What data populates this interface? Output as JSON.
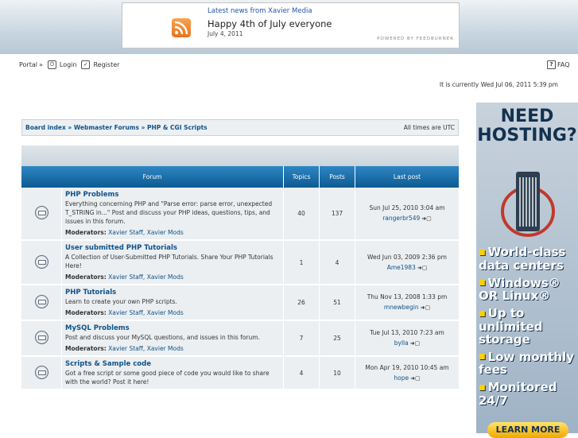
{
  "news": {
    "header": "Latest news from Xavier Media",
    "title": "Happy 4th of July everyone",
    "date": "July 4, 2011",
    "powered": "POWERED BY FEEDBURNER"
  },
  "nav": {
    "portal": "Portal",
    "sep": "»",
    "login": "Login",
    "register": "Register",
    "faq": "FAQ"
  },
  "current_time": "It is currently Wed Jul 06, 2011 5:39 pm",
  "breadcrumb": "Board index » Webmaster Forums » PHP & CGI Scripts",
  "timezone": "All times are UTC",
  "table": {
    "headers": {
      "forum": "Forum",
      "topics": "Topics",
      "posts": "Posts",
      "last": "Last post"
    },
    "mods_label": "Moderators:",
    "rows": [
      {
        "name": "PHP Problems",
        "desc": "Everything concerning PHP and \"Parse error: parse error, unexpected T_STRING in...\" Post and discuss your PHP ideas, questions, tips, and issues in this forum.",
        "mods": "Xavier Staff, Xavier Mods",
        "topics": "40",
        "posts": "137",
        "last_date": "Sun Jul 25, 2010 3:04 am",
        "last_user": "rangerbr549"
      },
      {
        "name": "User submitted PHP Tutorials",
        "desc": "A Collection of User-Submitted PHP Tutorials. Share Your PHP Tutorials Here!",
        "mods": "Xavier Staff, Xavier Mods",
        "topics": "1",
        "posts": "4",
        "last_date": "Wed Jun 03, 2009 2:36 pm",
        "last_user": "Ame1983"
      },
      {
        "name": "PHP Tutorials",
        "desc": "Learn to create your own PHP scripts.",
        "mods": "Xavier Staff, Xavier Mods",
        "topics": "26",
        "posts": "51",
        "last_date": "Thu Nov 13, 2008 1:33 pm",
        "last_user": "mnewbegin"
      },
      {
        "name": "MySQL Problems",
        "desc": "Post and discuss your MySQL questions, and issues in this forum.",
        "mods": "Xavier Staff, Xavier Mods",
        "topics": "7",
        "posts": "25",
        "last_date": "Tue Jul 13, 2010 7:23 am",
        "last_user": "bylla"
      },
      {
        "name": "Scripts & Sample code",
        "desc": "Got a free script or some good piece of code you would like to share with the world? Post it here!",
        "mods": "",
        "topics": "4",
        "posts": "10",
        "last_date": "Mon Apr 19, 2010 10:45 am",
        "last_user": "hope"
      }
    ]
  },
  "ad": {
    "headline_1": "NEED",
    "headline_2": "HOSTING?",
    "bullets": [
      "World-class data centers",
      "Windows® OR Linux®",
      "Up to unlimited storage",
      "Low monthly fees",
      "Monitored 24/7"
    ],
    "cta": "LEARN MORE"
  }
}
